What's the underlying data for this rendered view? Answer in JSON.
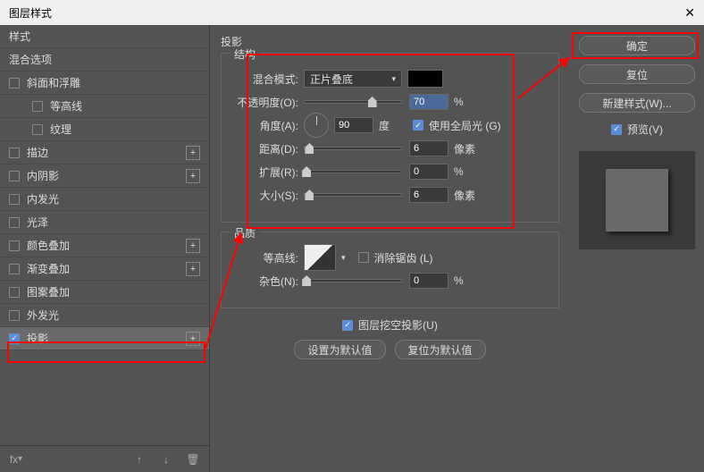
{
  "title": "图层样式",
  "sidebar": {
    "header": "样式",
    "blendopts": "混合选项",
    "items": [
      {
        "label": "斜面和浮雕",
        "checked": false,
        "plus": false
      },
      {
        "label": "等高线",
        "checked": false,
        "indent": true
      },
      {
        "label": "纹理",
        "checked": false,
        "indent": true
      },
      {
        "label": "描边",
        "checked": false,
        "plus": true
      },
      {
        "label": "内阴影",
        "checked": false,
        "plus": true
      },
      {
        "label": "内发光",
        "checked": false
      },
      {
        "label": "光泽",
        "checked": false
      },
      {
        "label": "颜色叠加",
        "checked": false,
        "plus": true
      },
      {
        "label": "渐变叠加",
        "checked": false,
        "plus": true
      },
      {
        "label": "图案叠加",
        "checked": false
      },
      {
        "label": "外发光",
        "checked": false
      },
      {
        "label": "投影",
        "checked": true,
        "plus": true,
        "active": true
      }
    ]
  },
  "main": {
    "title": "投影",
    "struct": {
      "legend": "结构",
      "blendmode_label": "混合模式:",
      "blendmode_value": "正片叠底",
      "opacity_label": "不透明度(O):",
      "opacity_value": "70",
      "opacity_unit": "%",
      "angle_label": "角度(A):",
      "angle_value": "90",
      "angle_unit": "度",
      "globallight": "使用全局光 (G)",
      "distance_label": "距离(D):",
      "distance_value": "6",
      "distance_unit": "像素",
      "spread_label": "扩展(R):",
      "spread_value": "0",
      "spread_unit": "%",
      "size_label": "大小(S):",
      "size_value": "6",
      "size_unit": "像素"
    },
    "quality": {
      "legend": "品质",
      "contour_label": "等高线:",
      "antialias": "消除锯齿 (L)",
      "noise_label": "杂色(N):",
      "noise_value": "0",
      "noise_unit": "%"
    },
    "knockout": "图层挖空投影(U)",
    "btn_default": "设置为默认值",
    "btn_reset": "复位为默认值"
  },
  "right": {
    "ok": "确定",
    "cancel": "复位",
    "newstyle": "新建样式(W)...",
    "preview": "预览(V)"
  }
}
